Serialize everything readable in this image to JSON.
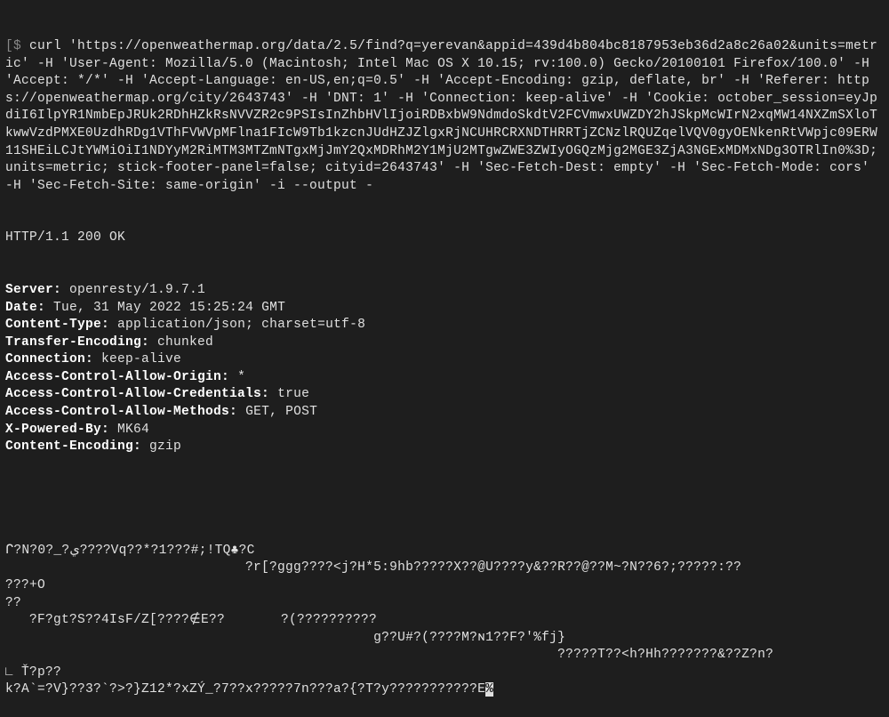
{
  "prompt_char": "[$",
  "command": "curl 'https://openweathermap.org/data/2.5/find?q=yerevan&appid=439d4b804bc8187953eb36d2a8c26a02&units=metric' -H 'User-Agent: Mozilla/5.0 (Macintosh; Intel Mac OS X 10.15; rv:100.0) Gecko/20100101 Firefox/100.0' -H 'Accept: */*' -H 'Accept-Language: en-US,en;q=0.5' -H 'Accept-Encoding: gzip, deflate, br' -H 'Referer: https://openweathermap.org/city/2643743' -H 'DNT: 1' -H 'Connection: keep-alive' -H 'Cookie: october_session=eyJpdiI6IlpYR1NmbEpJRUk2RDhHZkRsNVVZR2c9PSIsInZhbHVlIjoiRDBxbW9NdmdoSkdtV2FCVmwxUWZDY2hJSkpMcWIrN2xqMW14NXZmSXloTkwwVzdPMXE0UzdhRDg1VThFVWVpMFlna1FIcW9Tb1kzcnJUdHZJZlgxRjNCUHRCRXNDTHRRTjZCNzlRQUZqelVQV0gyOENkenRtVWpjc09ERW11SHEiLCJtYWMiOiI1NDYyM2RiMTM3MTZmNTgxMjJmY2QxMDRhM2Y1MjU2MTgwZWE3ZWIyOGQzMjg2MGE3ZjA3NGExMDMxNDg3OTRlIn0%3D; units=metric; stick-footer-panel=false; cityid=2643743' -H 'Sec-Fetch-Dest: empty' -H 'Sec-Fetch-Mode: cors' -H 'Sec-Fetch-Site: same-origin' -i --output -",
  "status_line": "HTTP/1.1 200 OK",
  "headers": [
    {
      "key": "Server",
      "val": "openresty/1.9.7.1"
    },
    {
      "key": "Date",
      "val": "Tue, 31 May 2022 15:25:24 GMT"
    },
    {
      "key": "Content-Type",
      "val": "application/json; charset=utf-8"
    },
    {
      "key": "Transfer-Encoding",
      "val": "chunked"
    },
    {
      "key": "Connection",
      "val": "keep-alive"
    },
    {
      "key": "Access-Control-Allow-Origin",
      "val": "*"
    },
    {
      "key": "Access-Control-Allow-Credentials",
      "val": "true"
    },
    {
      "key": "Access-Control-Allow-Methods",
      "val": "GET, POST"
    },
    {
      "key": "X-Powered-By",
      "val": "MK64"
    },
    {
      "key": "Content-Encoding",
      "val": "gzip"
    }
  ],
  "body_lines": [
    "ᒋ?N?0?_?ي????Vq??*?1???#;!TQ♣?C",
    "                              ?r[?ggg????<j?H*5:9hb?????X??@U????y&??R??@??M~?N??6?;?????:??",
    "???+O",
    "??",
    "   ?F?gt?S??4IsF/Z[????∉E??       ?(??????????",
    "                                              g??U#?(????M?ɴ1??F?'%fj}",
    "                                                                     ?????T??<h?Hh???????&??Z?n?",
    "∟ Ť?p??",
    "k?A`=?V}??3?`?>?}Z12*?xZÝ_?7??x?????7n???a?{?T?y???????????E"
  ],
  "trailing_percent": "%"
}
